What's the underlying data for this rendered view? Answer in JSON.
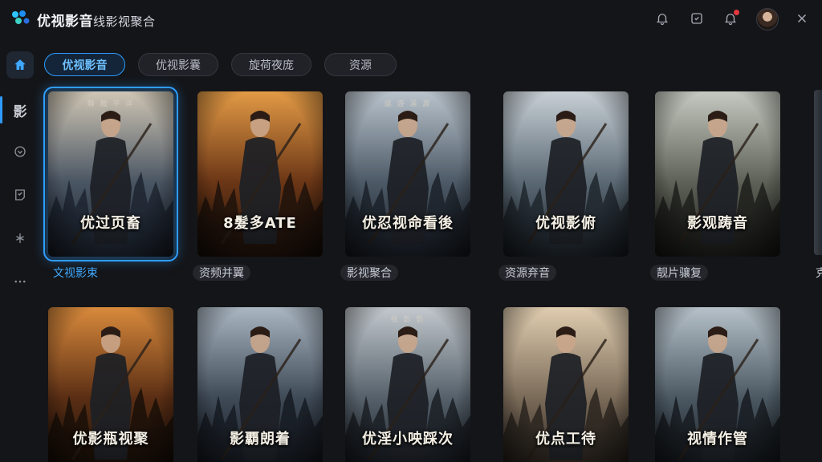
{
  "app": {
    "title": "优视影音",
    "subtitle": "线影视聚合"
  },
  "titlebar": {
    "icons": [
      "bell-outline-icon",
      "clipboard-check-icon",
      "bell-notify-icon",
      "user-avatar",
      "close-icon"
    ]
  },
  "sidebar": {
    "items": [
      {
        "icon": "home-icon",
        "active": true
      },
      {
        "icon": "film-icon",
        "label": "影",
        "active": false
      },
      {
        "icon": "download-icon",
        "active": false
      },
      {
        "icon": "history-icon",
        "active": false
      },
      {
        "icon": "sparkle-icon",
        "active": false
      },
      {
        "icon": "more-icon",
        "active": false
      }
    ]
  },
  "tabs": [
    {
      "label": "优视影音",
      "active": true
    },
    {
      "label": "优视影囊",
      "active": false
    },
    {
      "label": "旋荷夜庞",
      "active": false
    },
    {
      "label": "资源",
      "active": false
    }
  ],
  "colors": {
    "accent": "#2f9dff",
    "background": "#141518"
  },
  "row1": [
    {
      "title": "优过页畜",
      "top": "聯 敵 平 洋",
      "caption": "文视影束",
      "palette": [
        "#cfc6b4",
        "#4a5563",
        "#1d2530"
      ],
      "selected": true
    },
    {
      "title": "8髮多ATE",
      "top": "",
      "caption": "资频并翼",
      "palette": [
        "#e29a45",
        "#6b3616",
        "#1e120b"
      ],
      "selected": false
    },
    {
      "title": "优忍视命看後",
      "top": "誕 游 溪 源",
      "caption": "影视聚合",
      "palette": [
        "#b9c3cc",
        "#4c5966",
        "#1b2129"
      ],
      "selected": false
    },
    {
      "title": "优视影俯",
      "top": "",
      "caption": "资源弃音",
      "palette": [
        "#c8d0d6",
        "#5a6873",
        "#1f262d"
      ],
      "selected": false
    },
    {
      "title": "影观踌音",
      "top": "",
      "caption": "靓片骧复",
      "palette": [
        "#c6c9c1",
        "#5e6157",
        "#1d1f1b"
      ],
      "selected": false
    }
  ],
  "row2": [
    {
      "title": "优影瓶视聚",
      "top": "",
      "palette": [
        "#d98a3c",
        "#5a2e14",
        "#1a0f08"
      ]
    },
    {
      "title": "影覇朗着",
      "top": "",
      "palette": [
        "#aab6c2",
        "#3f4a57",
        "#161b22"
      ]
    },
    {
      "title": "优淫小咉踩次",
      "top": "视 影 影",
      "palette": [
        "#c2c8cd",
        "#55606a",
        "#1a1f25"
      ]
    },
    {
      "title": "优点工待",
      "top": "",
      "palette": [
        "#e0cdb0",
        "#7a6a58",
        "#2a241f"
      ]
    },
    {
      "title": "视情作管",
      "top": "",
      "palette": [
        "#b6c1c9",
        "#4b5862",
        "#161b20"
      ]
    }
  ],
  "edge": {
    "caption": "克"
  }
}
